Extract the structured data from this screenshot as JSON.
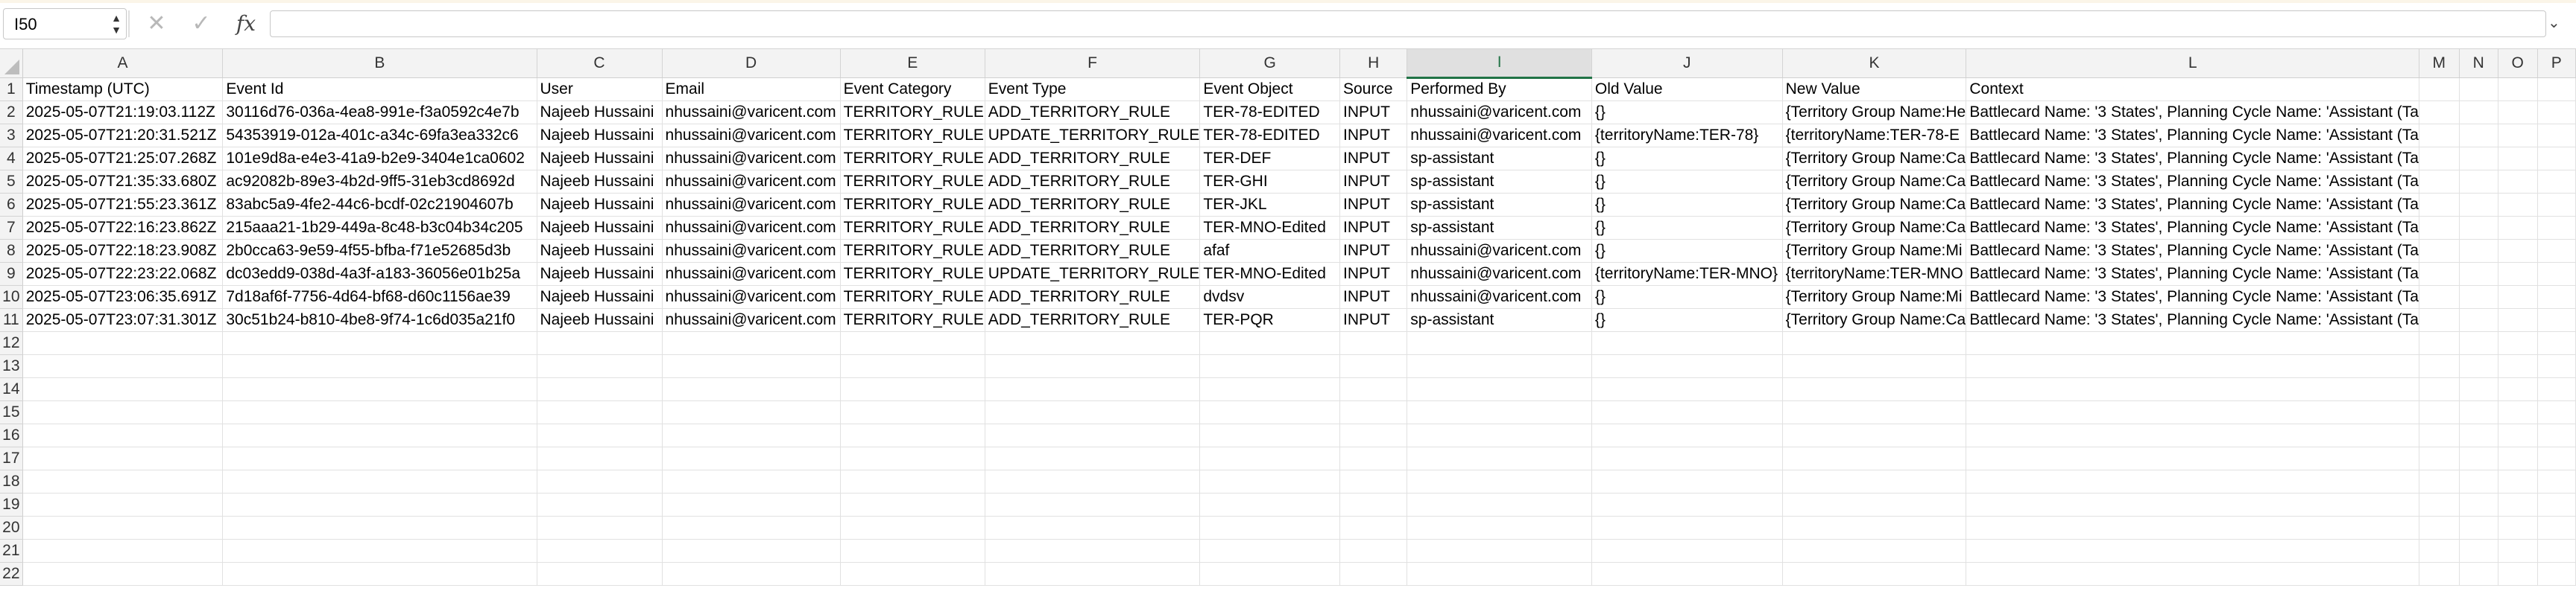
{
  "formula_bar": {
    "name_box": "I50",
    "cancel_icon": "close-icon",
    "enter_icon": "check-icon",
    "fx_label": "fx",
    "formula": ""
  },
  "columns": [
    "A",
    "B",
    "C",
    "D",
    "E",
    "F",
    "G",
    "H",
    "I",
    "J",
    "K",
    "L",
    "M",
    "N",
    "O",
    "P"
  ],
  "selected_column": "I",
  "headers": [
    "Timestamp (UTC)",
    "Event Id",
    "User",
    "Email",
    "Event Category",
    "Event Type",
    "Event Object",
    "Source",
    "Performed By",
    "Old Value",
    "New Value",
    "Context",
    "",
    "",
    "",
    ""
  ],
  "rows": [
    [
      "2025-05-07T21:19:03.112Z",
      "30116d76-036a-4ea8-991e-f3a0592c4e7b",
      "Najeeb Hussaini",
      "nhussaini@varicent.com",
      "TERRITORY_RULE",
      "ADD_TERRITORY_RULE",
      "TER-78-EDITED",
      "INPUT",
      "nhussaini@varicent.com",
      "{}",
      "{Territory Group Name:He",
      "Battlecard Name: '3 States', Planning Cycle Name: 'Assistant (Ta"
    ],
    [
      "2025-05-07T21:20:31.521Z",
      "54353919-012a-401c-a34c-69fa3ea332c6",
      "Najeeb Hussaini",
      "nhussaini@varicent.com",
      "TERRITORY_RULE",
      "UPDATE_TERRITORY_RULE",
      "TER-78-EDITED",
      "INPUT",
      "nhussaini@varicent.com",
      "{territoryName:TER-78}",
      "{territoryName:TER-78-E",
      "Battlecard Name: '3 States', Planning Cycle Name: 'Assistant (Ta"
    ],
    [
      "2025-05-07T21:25:07.268Z",
      "101e9d8a-e4e3-41a9-b2e9-3404e1ca0602",
      "Najeeb Hussaini",
      "nhussaini@varicent.com",
      "TERRITORY_RULE",
      "ADD_TERRITORY_RULE",
      "TER-DEF",
      "INPUT",
      "sp-assistant",
      "{}",
      "{Territory Group Name:Ca",
      "Battlecard Name: '3 States', Planning Cycle Name: 'Assistant (Ta"
    ],
    [
      "2025-05-07T21:35:33.680Z",
      "ac92082b-89e3-4b2d-9ff5-31eb3cd8692d",
      "Najeeb Hussaini",
      "nhussaini@varicent.com",
      "TERRITORY_RULE",
      "ADD_TERRITORY_RULE",
      "TER-GHI",
      "INPUT",
      "sp-assistant",
      "{}",
      "{Territory Group Name:Ca",
      "Battlecard Name: '3 States', Planning Cycle Name: 'Assistant (Ta"
    ],
    [
      "2025-05-07T21:55:23.361Z",
      "83abc5a9-4fe2-44c6-bcdf-02c21904607b",
      "Najeeb Hussaini",
      "nhussaini@varicent.com",
      "TERRITORY_RULE",
      "ADD_TERRITORY_RULE",
      "TER-JKL",
      "INPUT",
      "sp-assistant",
      "{}",
      "{Territory Group Name:Ca",
      "Battlecard Name: '3 States', Planning Cycle Name: 'Assistant (Ta"
    ],
    [
      "2025-05-07T22:16:23.862Z",
      "215aaa21-1b29-449a-8c48-b3c04b34c205",
      "Najeeb Hussaini",
      "nhussaini@varicent.com",
      "TERRITORY_RULE",
      "ADD_TERRITORY_RULE",
      "TER-MNO-Edited",
      "INPUT",
      "sp-assistant",
      "{}",
      "{Territory Group Name:Ca",
      "Battlecard Name: '3 States', Planning Cycle Name: 'Assistant (Ta"
    ],
    [
      "2025-05-07T22:18:23.908Z",
      "2b0cca63-9e59-4f55-bfba-f71e52685d3b",
      "Najeeb Hussaini",
      "nhussaini@varicent.com",
      "TERRITORY_RULE",
      "ADD_TERRITORY_RULE",
      "afaf",
      "INPUT",
      "nhussaini@varicent.com",
      "{}",
      "{Territory Group Name:Mi",
      "Battlecard Name: '3 States', Planning Cycle Name: 'Assistant (Ta"
    ],
    [
      "2025-05-07T22:23:22.068Z",
      "dc03edd9-038d-4a3f-a183-36056e01b25a",
      "Najeeb Hussaini",
      "nhussaini@varicent.com",
      "TERRITORY_RULE",
      "UPDATE_TERRITORY_RULE",
      "TER-MNO-Edited",
      "INPUT",
      "nhussaini@varicent.com",
      "{territoryName:TER-MNO}",
      "{territoryName:TER-MNO",
      "Battlecard Name: '3 States', Planning Cycle Name: 'Assistant (Ta"
    ],
    [
      "2025-05-07T23:06:35.691Z",
      "7d18af6f-7756-4d64-bf68-d60c1156ae39",
      "Najeeb Hussaini",
      "nhussaini@varicent.com",
      "TERRITORY_RULE",
      "ADD_TERRITORY_RULE",
      "dvdsv",
      "INPUT",
      "nhussaini@varicent.com",
      "{}",
      "{Territory Group Name:Mi",
      "Battlecard Name: '3 States', Planning Cycle Name: 'Assistant (Ta"
    ],
    [
      "2025-05-07T23:07:31.301Z",
      "30c51b24-b810-4be8-9f74-1c6d035a21f0",
      "Najeeb Hussaini",
      "nhussaini@varicent.com",
      "TERRITORY_RULE",
      "ADD_TERRITORY_RULE",
      "TER-PQR",
      "INPUT",
      "sp-assistant",
      "{}",
      "{Territory Group Name:Ca",
      "Battlecard Name: '3 States', Planning Cycle Name: 'Assistant (Ta"
    ]
  ],
  "empty_row_numbers": [
    "12",
    "13",
    "14",
    "15",
    "16",
    "17",
    "18",
    "19",
    "20",
    "21",
    "22"
  ],
  "colors": {
    "selected_header": "#217346",
    "grid_line": "#e1e1e1",
    "header_bg": "#f3f3f3"
  }
}
